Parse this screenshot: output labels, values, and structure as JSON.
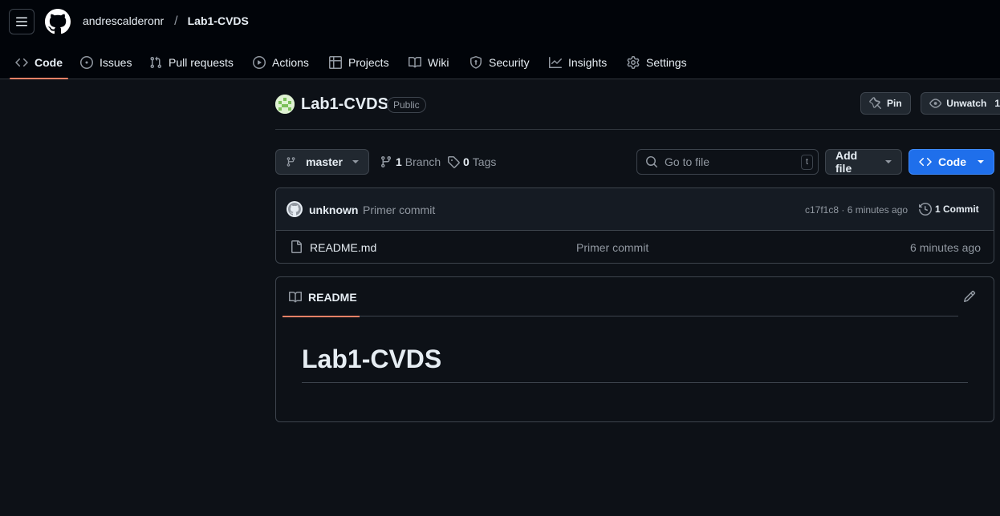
{
  "header": {
    "owner": "andrescalderonr",
    "separator": "/",
    "repo": "Lab1-CVDS"
  },
  "nav": {
    "items": [
      {
        "label": "Code",
        "icon": "code-icon",
        "active": true
      },
      {
        "label": "Issues",
        "icon": "issue-opened-icon"
      },
      {
        "label": "Pull requests",
        "icon": "git-pull-request-icon"
      },
      {
        "label": "Actions",
        "icon": "play-icon"
      },
      {
        "label": "Projects",
        "icon": "table-icon"
      },
      {
        "label": "Wiki",
        "icon": "book-icon"
      },
      {
        "label": "Security",
        "icon": "shield-icon"
      },
      {
        "label": "Insights",
        "icon": "graph-icon"
      },
      {
        "label": "Settings",
        "icon": "gear-icon"
      }
    ]
  },
  "repo": {
    "title": "Lab1-CVDS",
    "visibility": "Public",
    "pin_label": "Pin",
    "unwatch_label": "Unwatch",
    "watch_count": "1"
  },
  "toolbar": {
    "branch": "master",
    "branch_count": "1",
    "branch_label": "Branch",
    "tag_count": "0",
    "tag_label": "Tags",
    "goto_placeholder": "Go to file",
    "goto_shortcut": "t",
    "add_file_label": "Add file",
    "code_label": "Code"
  },
  "latest_commit": {
    "author": "unknown",
    "message": "Primer commit",
    "sha_time": "c17f1c8 · 6 minutes ago",
    "commit_count": "1 Commit"
  },
  "files": [
    {
      "name": "README.md",
      "message": "Primer commit",
      "age": "6 minutes ago"
    }
  ],
  "readme": {
    "tab_label": "README",
    "heading": "Lab1-CVDS"
  },
  "colors": {
    "accent_underline": "#f78166",
    "primary_button": "#1f6feb",
    "background": "#0d1117",
    "header_background": "#010409"
  }
}
